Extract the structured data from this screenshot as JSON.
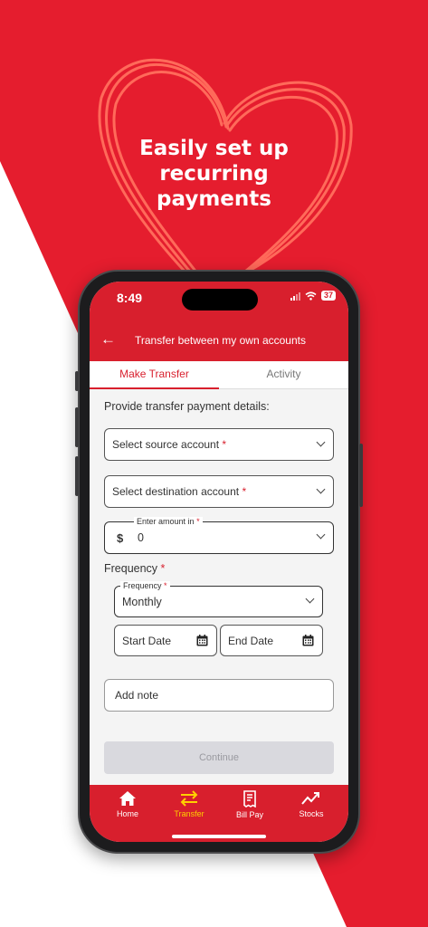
{
  "promo": {
    "headline_lines": [
      "Easily set up",
      "recurring",
      "payments"
    ]
  },
  "status_bar": {
    "time": "8:49",
    "battery": "37"
  },
  "app_bar": {
    "title": "Transfer between my own accounts"
  },
  "tabs": [
    {
      "label": "Make Transfer",
      "active": true
    },
    {
      "label": "Activity",
      "active": false
    }
  ],
  "form": {
    "prompt": "Provide transfer payment details:",
    "source_account": {
      "label": "Select source account",
      "required_mark": "*"
    },
    "destination_account": {
      "label": "Select destination account",
      "required_mark": "*"
    },
    "amount": {
      "floating_label": "Enter amount in",
      "required_mark": "*",
      "currency": "$",
      "value": "0"
    },
    "frequency_section": {
      "label": "Frequency",
      "required_mark": "*"
    },
    "frequency": {
      "floating_label": "Frequency",
      "required_mark": "*",
      "value": "Monthly"
    },
    "start_date": {
      "placeholder": "Start Date"
    },
    "end_date": {
      "placeholder": "End Date"
    },
    "note": {
      "placeholder": "Add note"
    },
    "continue_label": "Continue"
  },
  "bottom_nav": [
    {
      "label": "Home",
      "icon": "home-icon"
    },
    {
      "label": "Transfer",
      "icon": "transfer-icon",
      "active": true
    },
    {
      "label": "Bill Pay",
      "icon": "bill-icon"
    },
    {
      "label": "Stocks",
      "icon": "stocks-icon"
    }
  ],
  "colors": {
    "brand_red": "#e51d2e",
    "active_nav": "#ffd000",
    "disabled_button": "#d9d9de"
  }
}
